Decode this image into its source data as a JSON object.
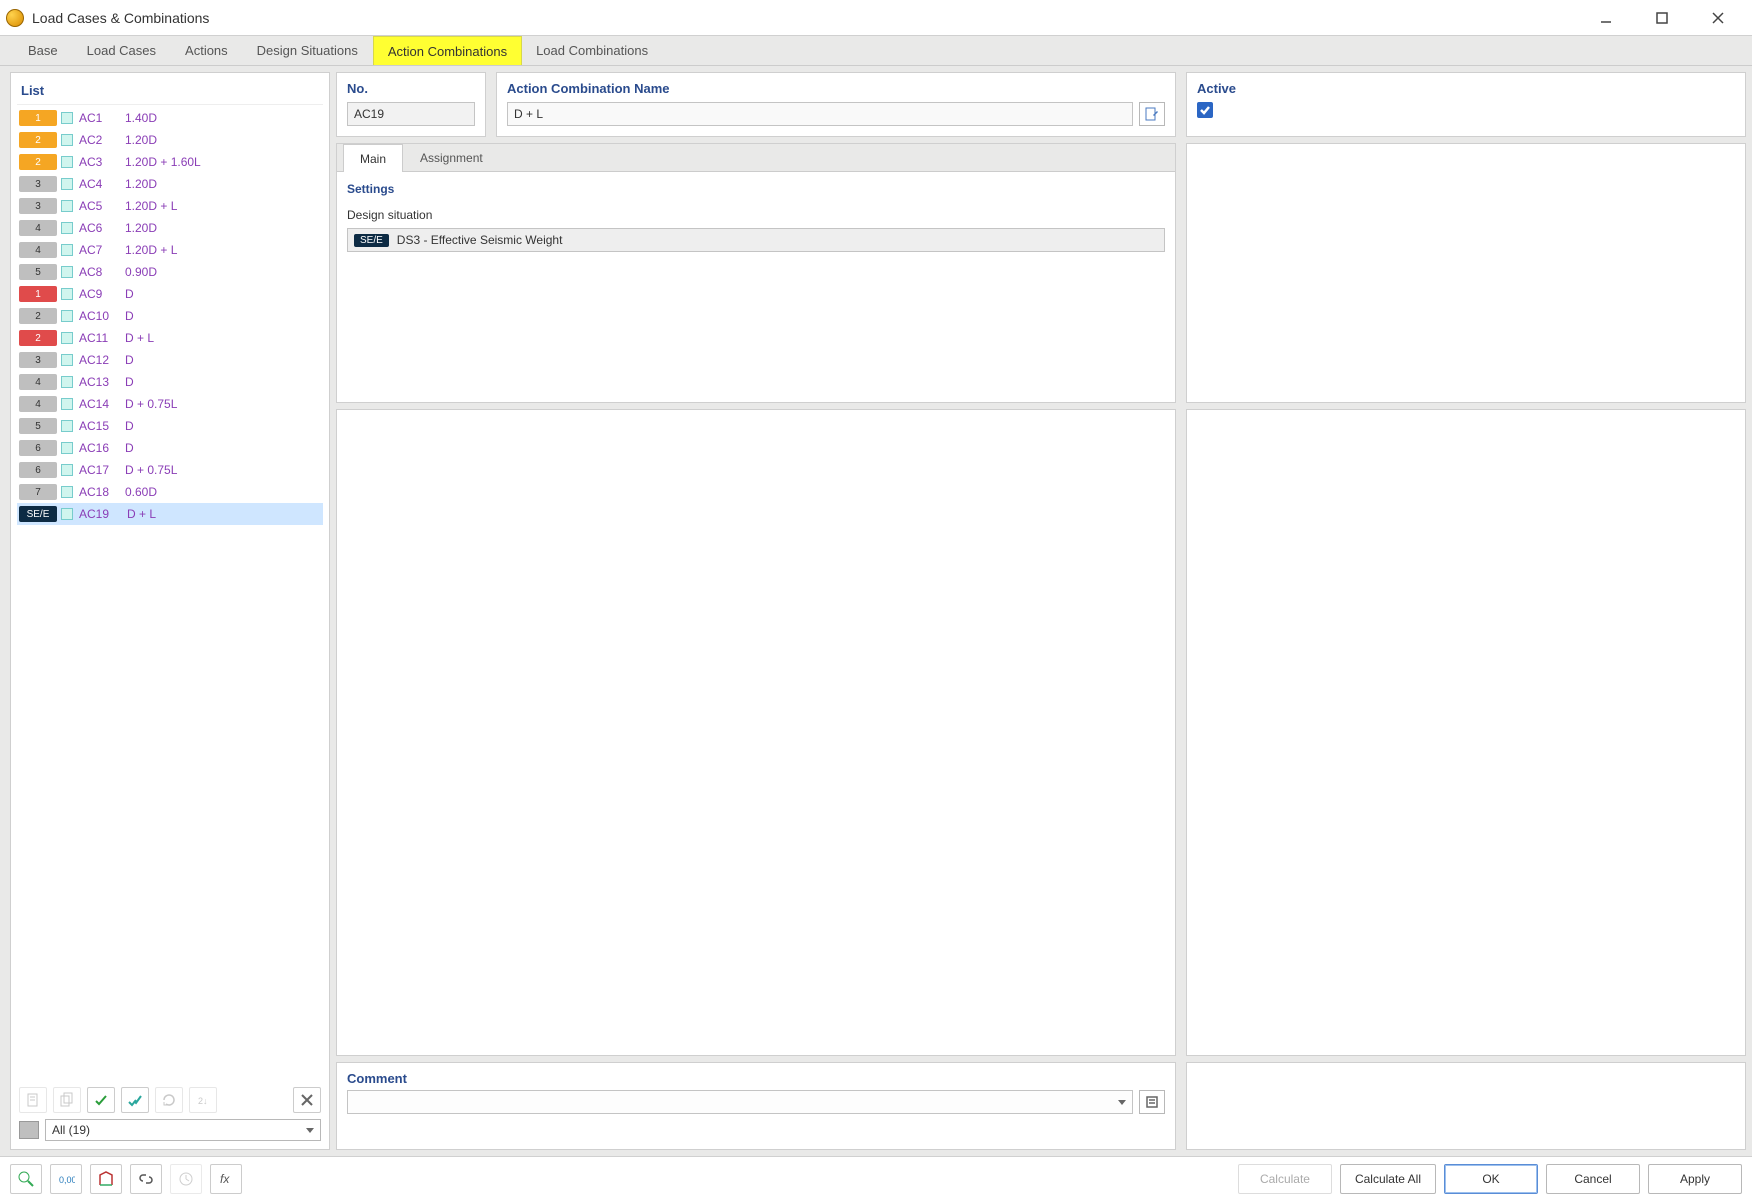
{
  "window": {
    "title": "Load Cases & Combinations"
  },
  "tabs": [
    {
      "label": "Base"
    },
    {
      "label": "Load Cases"
    },
    {
      "label": "Actions"
    },
    {
      "label": "Design Situations"
    },
    {
      "label": "Action Combinations",
      "active": true
    },
    {
      "label": "Load Combinations"
    }
  ],
  "list": {
    "header": "List",
    "items": [
      {
        "badge": "1",
        "color": "orange",
        "code": "AC1",
        "name": "1.40D"
      },
      {
        "badge": "2",
        "color": "orange",
        "code": "AC2",
        "name": "1.20D"
      },
      {
        "badge": "2",
        "color": "orange",
        "code": "AC3",
        "name": "1.20D + 1.60L"
      },
      {
        "badge": "3",
        "color": "gray",
        "code": "AC4",
        "name": "1.20D"
      },
      {
        "badge": "3",
        "color": "gray",
        "code": "AC5",
        "name": "1.20D + L"
      },
      {
        "badge": "4",
        "color": "gray",
        "code": "AC6",
        "name": "1.20D"
      },
      {
        "badge": "4",
        "color": "gray",
        "code": "AC7",
        "name": "1.20D + L"
      },
      {
        "badge": "5",
        "color": "gray",
        "code": "AC8",
        "name": "0.90D"
      },
      {
        "badge": "1",
        "color": "red",
        "code": "AC9",
        "name": "D"
      },
      {
        "badge": "2",
        "color": "gray",
        "code": "AC10",
        "name": "D"
      },
      {
        "badge": "2",
        "color": "red",
        "code": "AC11",
        "name": "D + L"
      },
      {
        "badge": "3",
        "color": "gray",
        "code": "AC12",
        "name": "D"
      },
      {
        "badge": "4",
        "color": "gray",
        "code": "AC13",
        "name": "D"
      },
      {
        "badge": "4",
        "color": "gray",
        "code": "AC14",
        "name": "D + 0.75L"
      },
      {
        "badge": "5",
        "color": "gray",
        "code": "AC15",
        "name": "D"
      },
      {
        "badge": "6",
        "color": "gray",
        "code": "AC16",
        "name": "D"
      },
      {
        "badge": "6",
        "color": "gray",
        "code": "AC17",
        "name": "D + 0.75L"
      },
      {
        "badge": "7",
        "color": "gray",
        "code": "AC18",
        "name": "0.60D"
      },
      {
        "badge": "SE/E",
        "color": "se",
        "code": "AC19",
        "name": "D + L",
        "selected": true
      }
    ],
    "filter_label": "All (19)"
  },
  "details": {
    "no_header": "No.",
    "no_value": "AC19",
    "name_header": "Action Combination Name",
    "name_value": "D + L",
    "active_header": "Active",
    "active_checked": true,
    "subtabs": [
      {
        "label": "Main",
        "active": true
      },
      {
        "label": "Assignment"
      }
    ],
    "settings_header": "Settings",
    "design_situation_label": "Design situation",
    "design_situation_chip": "SE/E",
    "design_situation_value": "DS3 - Effective Seismic Weight",
    "comment_header": "Comment",
    "comment_value": ""
  },
  "buttons": {
    "calculate": "Calculate",
    "calculate_all": "Calculate All",
    "ok": "OK",
    "cancel": "Cancel",
    "apply": "Apply"
  }
}
